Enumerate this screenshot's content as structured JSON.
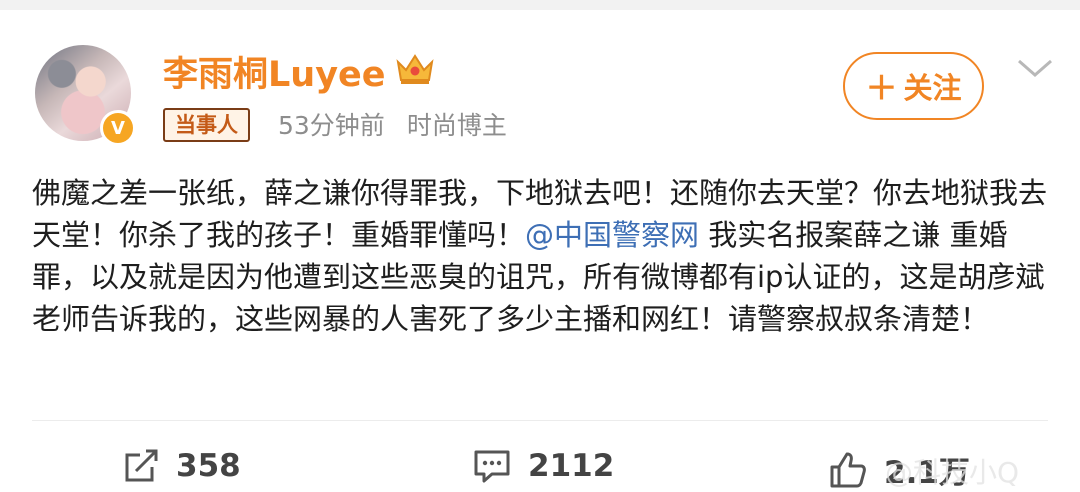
{
  "user": {
    "name": "李雨桐Luyee",
    "verified_badge": "V",
    "tag": "当事人",
    "time": "53分钟前",
    "category": "时尚博主",
    "crown_icon": "crown-icon"
  },
  "follow_button": {
    "label": "关注",
    "icon": "plus-icon"
  },
  "post": {
    "text_part1": "佛魔之差一张纸，薛之谦你得罪我，下地狱去吧！还随你去天堂？你去地狱我去天堂！你杀了我的孩子！重婚罪懂吗！",
    "mention": "@中国警察网",
    "text_part2": " 我实名报案薛之谦 重婚罪，以及就是因为他遭到这些恶臭的诅咒，所有微博都有ip认证的，这是胡彦斌老师告诉我的，这些网暴的人害死了多少主播和网红！请警察叔叔条清楚！"
  },
  "actions": {
    "repost_count": "358",
    "comment_count": "2112",
    "like_count": "2.1万"
  },
  "watermark": "@科技小Q",
  "colors": {
    "accent": "#f18524",
    "mention": "#3e6fb5",
    "meta": "#8d8d8d"
  }
}
